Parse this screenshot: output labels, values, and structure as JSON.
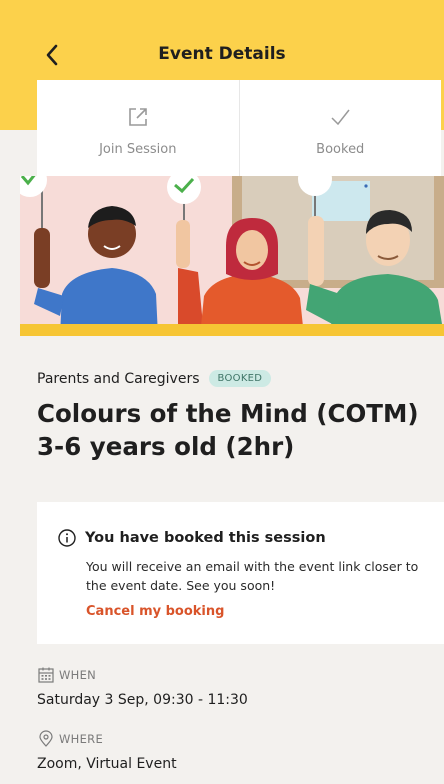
{
  "header": {
    "title": "Event Details",
    "back_icon": "chevron-left-icon"
  },
  "actions": [
    {
      "label": "Join Session",
      "icon": "external-link-icon"
    },
    {
      "label": "Booked",
      "icon": "checkmark-icon"
    }
  ],
  "event": {
    "category": "Parents and Caregivers",
    "status_badge": "BOOKED",
    "title_line1": "Colours of the Mind (COTM)",
    "title_line2": "3-6 years old (2hr)"
  },
  "notice": {
    "title": "You have booked this session",
    "body": "You will receive an email with the event link closer to the event date. See you soon!",
    "cancel_link": "Cancel my booking"
  },
  "details": {
    "when_label": "WHEN",
    "when_value": "Saturday 3 Sep, 09:30 - 11:30",
    "where_label": "WHERE",
    "where_value": "Zoom, Virtual Event"
  },
  "colors": {
    "header_bg": "#fcd14b",
    "page_bg": "#f3f1ee",
    "badge_bg": "#cdeae4",
    "badge_text": "#3e7466",
    "cancel_link": "#d9542a"
  }
}
